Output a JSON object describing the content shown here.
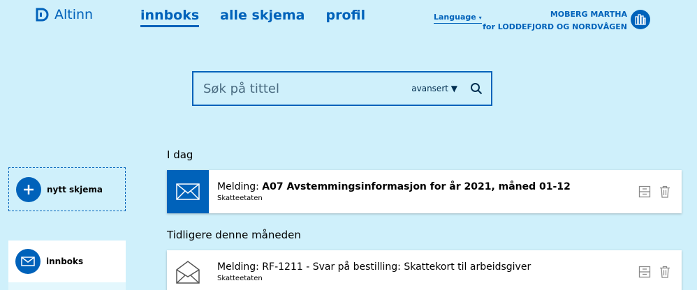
{
  "header": {
    "logo_text": "Altinn",
    "nav": [
      {
        "label": "innboks",
        "active": true
      },
      {
        "label": "alle skjema",
        "active": false
      },
      {
        "label": "profil",
        "active": false
      }
    ],
    "language_label": "Language",
    "user_name": "MOBERG MARTHA",
    "user_org": "for LODDEFJORD OG NORDVÅGEN"
  },
  "search": {
    "placeholder": "Søk på tittel",
    "advanced_label": "avansert ▼"
  },
  "sidebar": {
    "new_form_label": "nytt skjema",
    "inbox_label": "innboks"
  },
  "sections": [
    {
      "title": "I dag",
      "messages": [
        {
          "prefix": "Melding: ",
          "subject": "A07 Avstemmingsinformasjon for år 2021, måned 01-12",
          "sender": "Skatteetaten",
          "unread": true
        }
      ]
    },
    {
      "title": "Tidligere denne måneden",
      "messages": [
        {
          "prefix": "Melding: ",
          "subject": "RF-1211 - Svar på bestilling: Skattekort til arbeidsgiver",
          "sender": "Skatteetaten",
          "unread": false
        }
      ]
    }
  ],
  "colors": {
    "accent": "#0062ba",
    "background": "#cff0fb"
  }
}
